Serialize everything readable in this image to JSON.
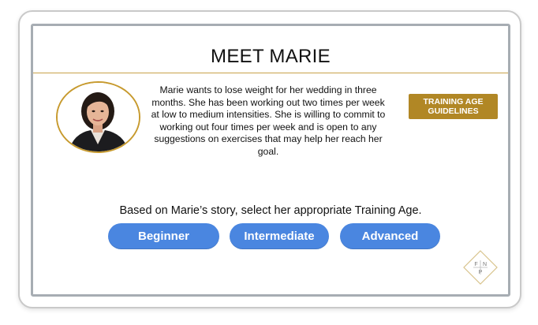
{
  "card": {
    "title": "MEET MARIE",
    "story": "Marie wants to lose weight for her wedding in three months. She has been working out two times per week at low to medium intensities. She is willing to commit to working out four times per week and is open to any suggestions on exercises that may help her reach her goal.",
    "guidelines_button": "TRAINING AGE GUIDELINES",
    "prompt": "Based on Marie’s story, select her appropriate Training Age.",
    "options": [
      "Beginner",
      "Intermediate",
      "Advanced"
    ]
  },
  "logo": {
    "letters": [
      "F",
      "N",
      "P"
    ]
  },
  "colors": {
    "accent_gold": "#b18725",
    "option_blue": "#4a86e0",
    "frame_gray": "#a7adb3"
  },
  "icons": {
    "avatar": "portrait-photo",
    "logo": "fnp-diamond-logo"
  }
}
